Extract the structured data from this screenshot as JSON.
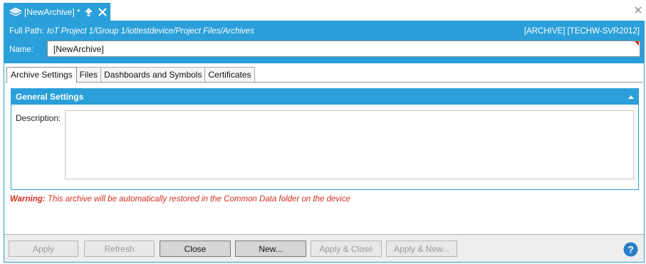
{
  "window": {
    "tab_title": "[NewArchive] *",
    "tab_icons": [
      "layers-icon",
      "pin-up-icon",
      "close-icon"
    ],
    "close_icon": "close-icon",
    "accent_color": "#2a9fd9"
  },
  "header": {
    "path_label": "Full Path:",
    "path_value": "IoT Project 1/Group 1/iottestdevice/Project Files/Archives",
    "type_server": "[ARCHIVE] [TECHW-SVR2012]",
    "name_label": "Name:",
    "name_value": "[NewArchive]"
  },
  "tabs": [
    {
      "label": "Archive Settings",
      "active": true
    },
    {
      "label": "Files",
      "active": false
    },
    {
      "label": "Dashboards and Symbols",
      "active": false
    },
    {
      "label": "Certificates",
      "active": false
    }
  ],
  "general_settings": {
    "title": "General Settings",
    "collapse_icon": "chevron-up-icon",
    "description_label": "Description:",
    "description_value": ""
  },
  "warning": {
    "label": "Warning:",
    "text": " This archive will be automatically restored in the Common Data folder on the device",
    "color": "#d32f1e"
  },
  "footer": {
    "buttons": [
      {
        "label": "Apply",
        "enabled": false
      },
      {
        "label": "Refresh",
        "enabled": false
      },
      {
        "label": "Close",
        "enabled": true
      },
      {
        "label": "New...",
        "enabled": true
      },
      {
        "label": "Apply & Close",
        "enabled": false
      },
      {
        "label": "Apply & New...",
        "enabled": false
      }
    ],
    "help_icon": "help-icon"
  }
}
